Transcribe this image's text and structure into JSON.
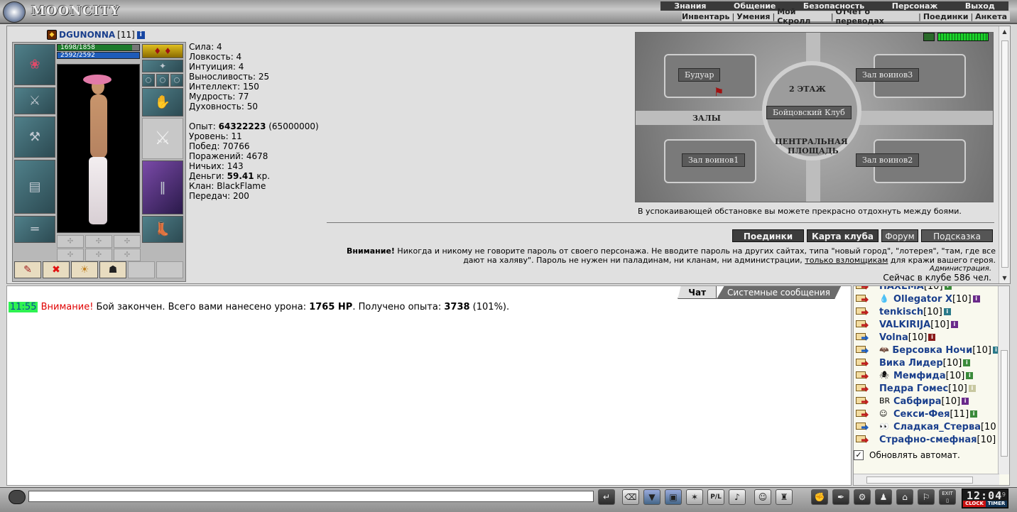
{
  "app": {
    "logo_text": "MOONCITY"
  },
  "menu": {
    "main": [
      "Знания",
      "Общение",
      "Безопасность",
      "Персонаж",
      "Выход"
    ],
    "sub": [
      "Инвентарь",
      "Умения",
      "Мой Скролл",
      "Отчет о переводах",
      "Поединки",
      "Анкета"
    ]
  },
  "character": {
    "name": "DGUNONNA",
    "level": "[11]",
    "hp": "1698/1858",
    "hp_fraction": 0.914,
    "mana": "2592/2592",
    "mana_fraction": 1.0,
    "stats": {
      "strength": "Сила: 4",
      "agility": "Ловкость: 4",
      "intuition": "Интуиция: 4",
      "endurance": "Выносливость: 25",
      "intellect": "Интеллект: 150",
      "wisdom": "Мудрость: 77",
      "spirit": "Духовность: 50"
    },
    "exp_label": "Опыт: ",
    "exp_value": "64322223",
    "exp_next": " (65000000)",
    "level_line": "Уровень: 11",
    "wins": "Побед: 70766",
    "losses": "Поражений: 4678",
    "draws": "Ничьих: 143",
    "money_label": "Деньги: ",
    "money_value": "59.41",
    "money_unit": " кр.",
    "clan": "Клан: BlackFlame",
    "transfers": "Передач: 200"
  },
  "location": {
    "plates": {
      "boudoir": "Будуар",
      "hall3": "Зал воинов3",
      "fight_club": "Бойцовский Клуб",
      "hall1": "Зал воинов1",
      "hall2": "Зал воинов2"
    },
    "labels": {
      "floor2": "2 ЭТАЖ",
      "halls": "ЗАЛЫ",
      "central_1": "ЦЕНТРАЛЬНАЯ",
      "central_2": "ПЛОЩАДЬ"
    },
    "note": "В успокаивающей обстановке вы можете прекрасно отдохнуть между боями.",
    "buttons": [
      "Поединки",
      "Карта клуба",
      "Форум",
      "Подсказка"
    ]
  },
  "warning": {
    "title": "Внимание!",
    "text1": " Никогда и никому не говорите пароль от своего персонажа. Не вводите пароль на других сайтах, типа \"новый город\", \"лотерея\", \"там, где все дают на халяву\". Пароль не нужен ни паладинам, ни кланам, ни администрации, ",
    "link": "только взломщикам",
    "text2": " для кражи вашего героя.",
    "admin": "Администрация.",
    "online": "Сейчас в клубе 586 чел."
  },
  "chat": {
    "tabs": [
      "Чат",
      "Системные сообщения"
    ],
    "message": {
      "time": "11:55",
      "warn": "Внимание!",
      "text1": " Бой закончен. Всего вами нанесено урона: ",
      "damage": "1765 HP",
      "text2": ". Получено опыта: ",
      "exp": "3738",
      "text3": " (101%)."
    },
    "input_value": ""
  },
  "users": [
    {
      "name": "HAXEMA",
      "level": "[10]",
      "icon": "",
      "pm": "red",
      "info": "#3a8a3a"
    },
    {
      "name": "Ollegator X",
      "level": "[10]",
      "icon": "💧",
      "pm": "red",
      "info": "#6a2a8a"
    },
    {
      "name": "tenkisch",
      "level": "[10]",
      "icon": "",
      "pm": "red",
      "info": "#2a7a8a"
    },
    {
      "name": "VALKIRIJA",
      "level": "[10]",
      "icon": "",
      "pm": "red",
      "info": "#6a2a8a"
    },
    {
      "name": "Volna",
      "level": "[10]",
      "icon": "",
      "pm": "blue",
      "info": "#8a1a1a"
    },
    {
      "name": "Берсовка Ночи",
      "level": "[10]",
      "icon": "🦇",
      "pm": "blue",
      "info": "#2a7a8a"
    },
    {
      "name": "Вика Лидер",
      "level": "[10]",
      "icon": "",
      "pm": "red",
      "info": "#3a8a3a"
    },
    {
      "name": "Мемфида",
      "level": "[10]",
      "icon": "🕷",
      "pm": "red",
      "info": "#3a8a3a"
    },
    {
      "name": "Педра Гомес",
      "level": "[10]",
      "icon": "",
      "pm": "red",
      "info": "#c8c8a0"
    },
    {
      "name": "Сабфира",
      "level": "[10]",
      "icon": "BR",
      "pm": "red",
      "info": "#6a2a8a"
    },
    {
      "name": "Секси-Фея",
      "level": "[11]",
      "icon": "☺",
      "pm": "red",
      "info": "#3a8a3a"
    },
    {
      "name": "Сладкая_Стерва",
      "level": "[10",
      "icon": "👀",
      "pm": "blue",
      "info": ""
    },
    {
      "name": "Страфно-смефная",
      "level": "[10]",
      "icon": "",
      "pm": "red",
      "info": ""
    }
  ],
  "auto_update": {
    "label": "Обновлять автомат.",
    "checked": "✓"
  },
  "clock": {
    "time": "12:04",
    "seconds": "19",
    "clock_label": "CLOCK",
    "timer_label": "TIMER"
  },
  "toolbar": {
    "exit_label": "EXIT",
    "pl_label": "P/L"
  }
}
